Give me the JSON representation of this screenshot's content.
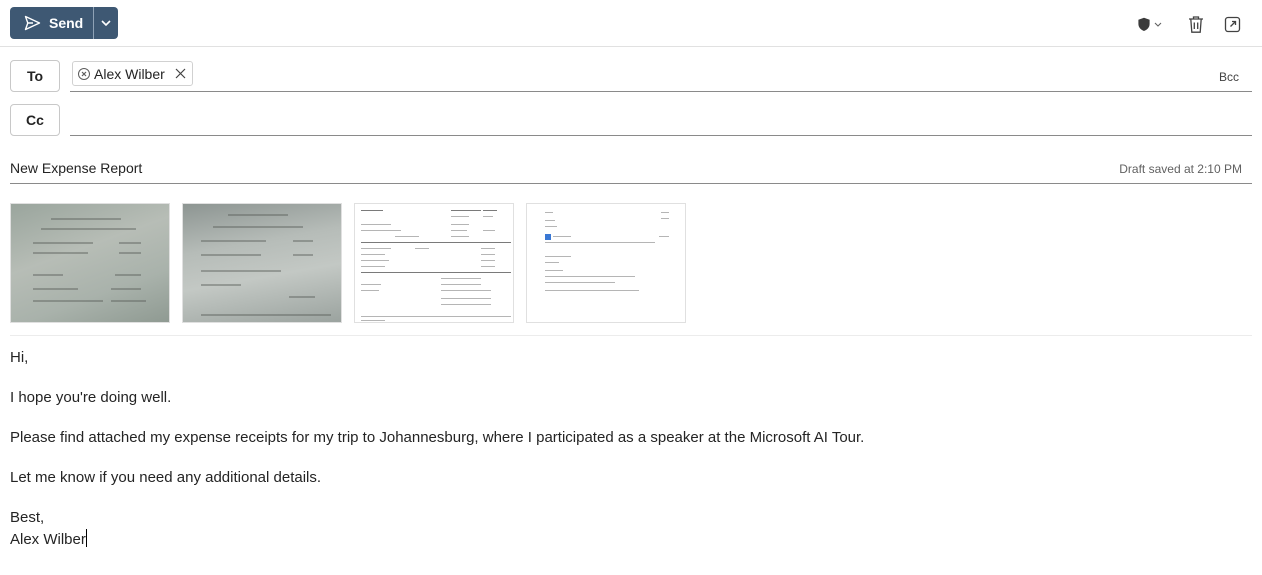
{
  "toolbar": {
    "send_label": "Send"
  },
  "recipients": {
    "to_label": "To",
    "cc_label": "Cc",
    "bcc_label": "Bcc",
    "to": [
      {
        "name": "Alex Wilber"
      }
    ]
  },
  "subject": {
    "value": "New Expense Report",
    "draft_status": "Draft saved at 2:10 PM"
  },
  "attachments": [
    {
      "kind": "receipt-photo"
    },
    {
      "kind": "receipt-photo"
    },
    {
      "kind": "invoice-document"
    },
    {
      "kind": "confirmation-document"
    }
  ],
  "body": {
    "greeting": "Hi,",
    "line1": "I hope you're doing well.",
    "line2": "Please find attached my expense receipts for my trip to Johannesburg, where I participated as a speaker at the Microsoft AI Tour.",
    "line3": "Let me know if you need any additional details.",
    "closing": "Best,",
    "signature": "Alex Wilber"
  },
  "colors": {
    "send_button": "#3e5873",
    "text": "#242424",
    "divider": "#8a8a8a"
  }
}
